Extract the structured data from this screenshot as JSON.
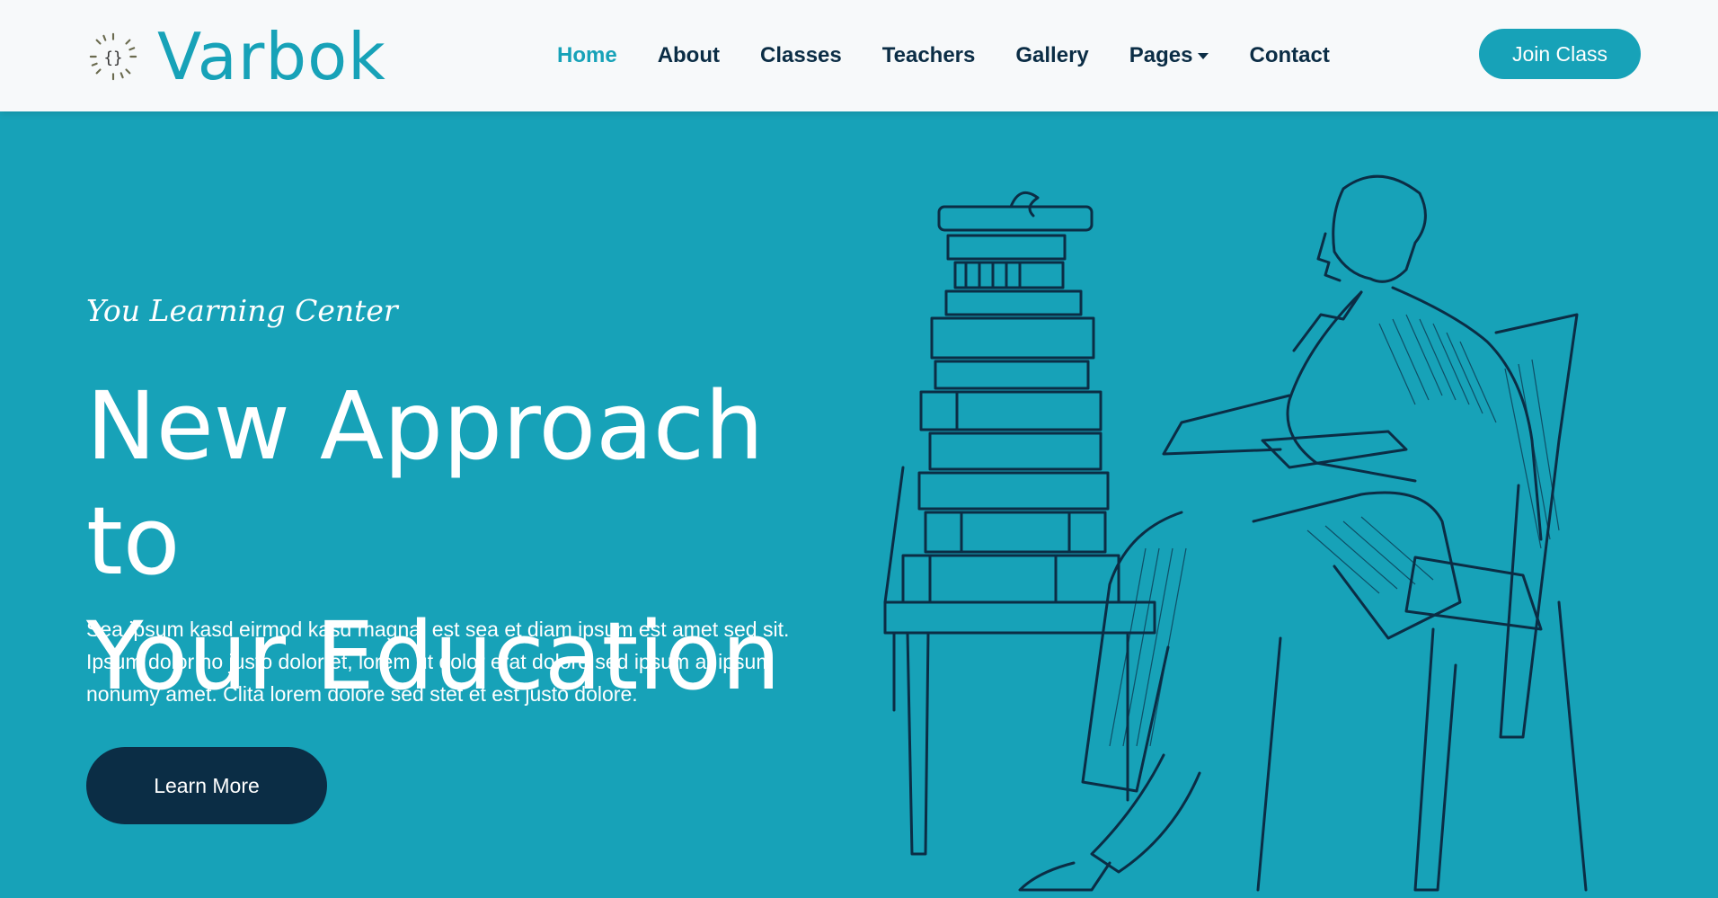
{
  "brand": {
    "name": "Varbok",
    "accent_color": "#17A2B8",
    "logo_icon": "book-braces-icon"
  },
  "nav": {
    "items": [
      {
        "label": "Home",
        "active": true
      },
      {
        "label": "About"
      },
      {
        "label": "Classes"
      },
      {
        "label": "Teachers"
      },
      {
        "label": "Gallery"
      },
      {
        "label": "Pages",
        "dropdown": true
      },
      {
        "label": "Contact"
      }
    ],
    "cta_label": "Join Class"
  },
  "hero": {
    "subtitle": "You Learning Center",
    "title_line1": "New Approach to",
    "title_line2": "Your Education",
    "text": "Sea ipsum kasd eirmod kasd magna, est sea et diam ipsum est amet sed sit. Ipsum dolor no justo dolor et, lorem ut dolor erat dolore sed ipsum at ipsum nonumy amet. Clita lorem dolore sed stet et est justo dolore.",
    "button_label": "Learn More",
    "illustration_icon": "man-with-books-sketch-icon"
  },
  "colors": {
    "hero_bg": "#17A2B8",
    "navbar_bg": "#F7F9FA",
    "dark": "#0B2D45"
  }
}
